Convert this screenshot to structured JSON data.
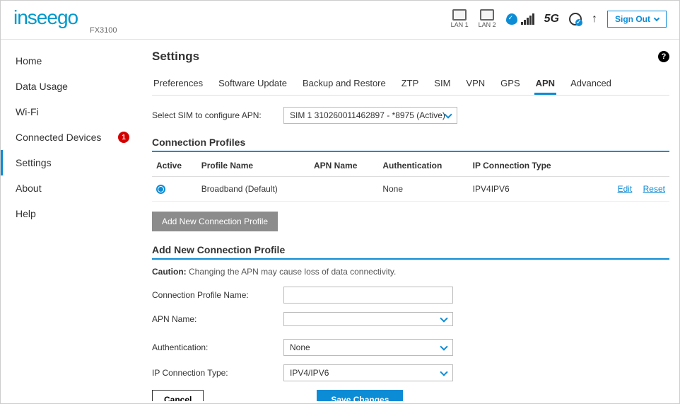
{
  "brand": "inseego",
  "model": "FX3100",
  "header": {
    "lan1": "LAN 1",
    "lan2": "LAN 2",
    "net_tech": "5G",
    "signout": "Sign Out"
  },
  "sidebar": {
    "items": [
      {
        "label": "Home"
      },
      {
        "label": "Data Usage"
      },
      {
        "label": "Wi-Fi"
      },
      {
        "label": "Connected Devices",
        "badge": "1"
      },
      {
        "label": "Settings",
        "active": true
      },
      {
        "label": "About"
      },
      {
        "label": "Help"
      }
    ]
  },
  "page": {
    "title": "Settings",
    "tabs": [
      "Preferences",
      "Software Update",
      "Backup and Restore",
      "ZTP",
      "SIM",
      "VPN",
      "GPS",
      "APN",
      "Advanced"
    ],
    "active_tab": "APN",
    "sim_label": "Select SIM to configure APN:",
    "sim_value": "SIM 1 310260011462897 - *8975 (Active)",
    "profiles_title": "Connection Profiles",
    "columns": {
      "active": "Active",
      "name": "Profile Name",
      "apn": "APN Name",
      "auth": "Authentication",
      "ip": "IP Connection Type"
    },
    "profiles": [
      {
        "active": true,
        "name": "Broadband (Default)",
        "apn": "",
        "auth": "None",
        "ip": "IPV4IPV6"
      }
    ],
    "edit_label": "Edit",
    "reset_label": "Reset",
    "add_btn": "Add New Connection Profile",
    "add_title": "Add New Connection Profile",
    "caution_label": "Caution:",
    "caution_text": "Changing the APN may cause loss of data connectivity.",
    "form": {
      "name_label": "Connection Profile Name:",
      "name_value": "",
      "apn_label": "APN Name:",
      "apn_value": "",
      "auth_label": "Authentication:",
      "auth_value": "None",
      "ip_label": "IP Connection Type:",
      "ip_value": "IPV4/IPV6",
      "cancel": "Cancel",
      "save": "Save Changes"
    }
  }
}
